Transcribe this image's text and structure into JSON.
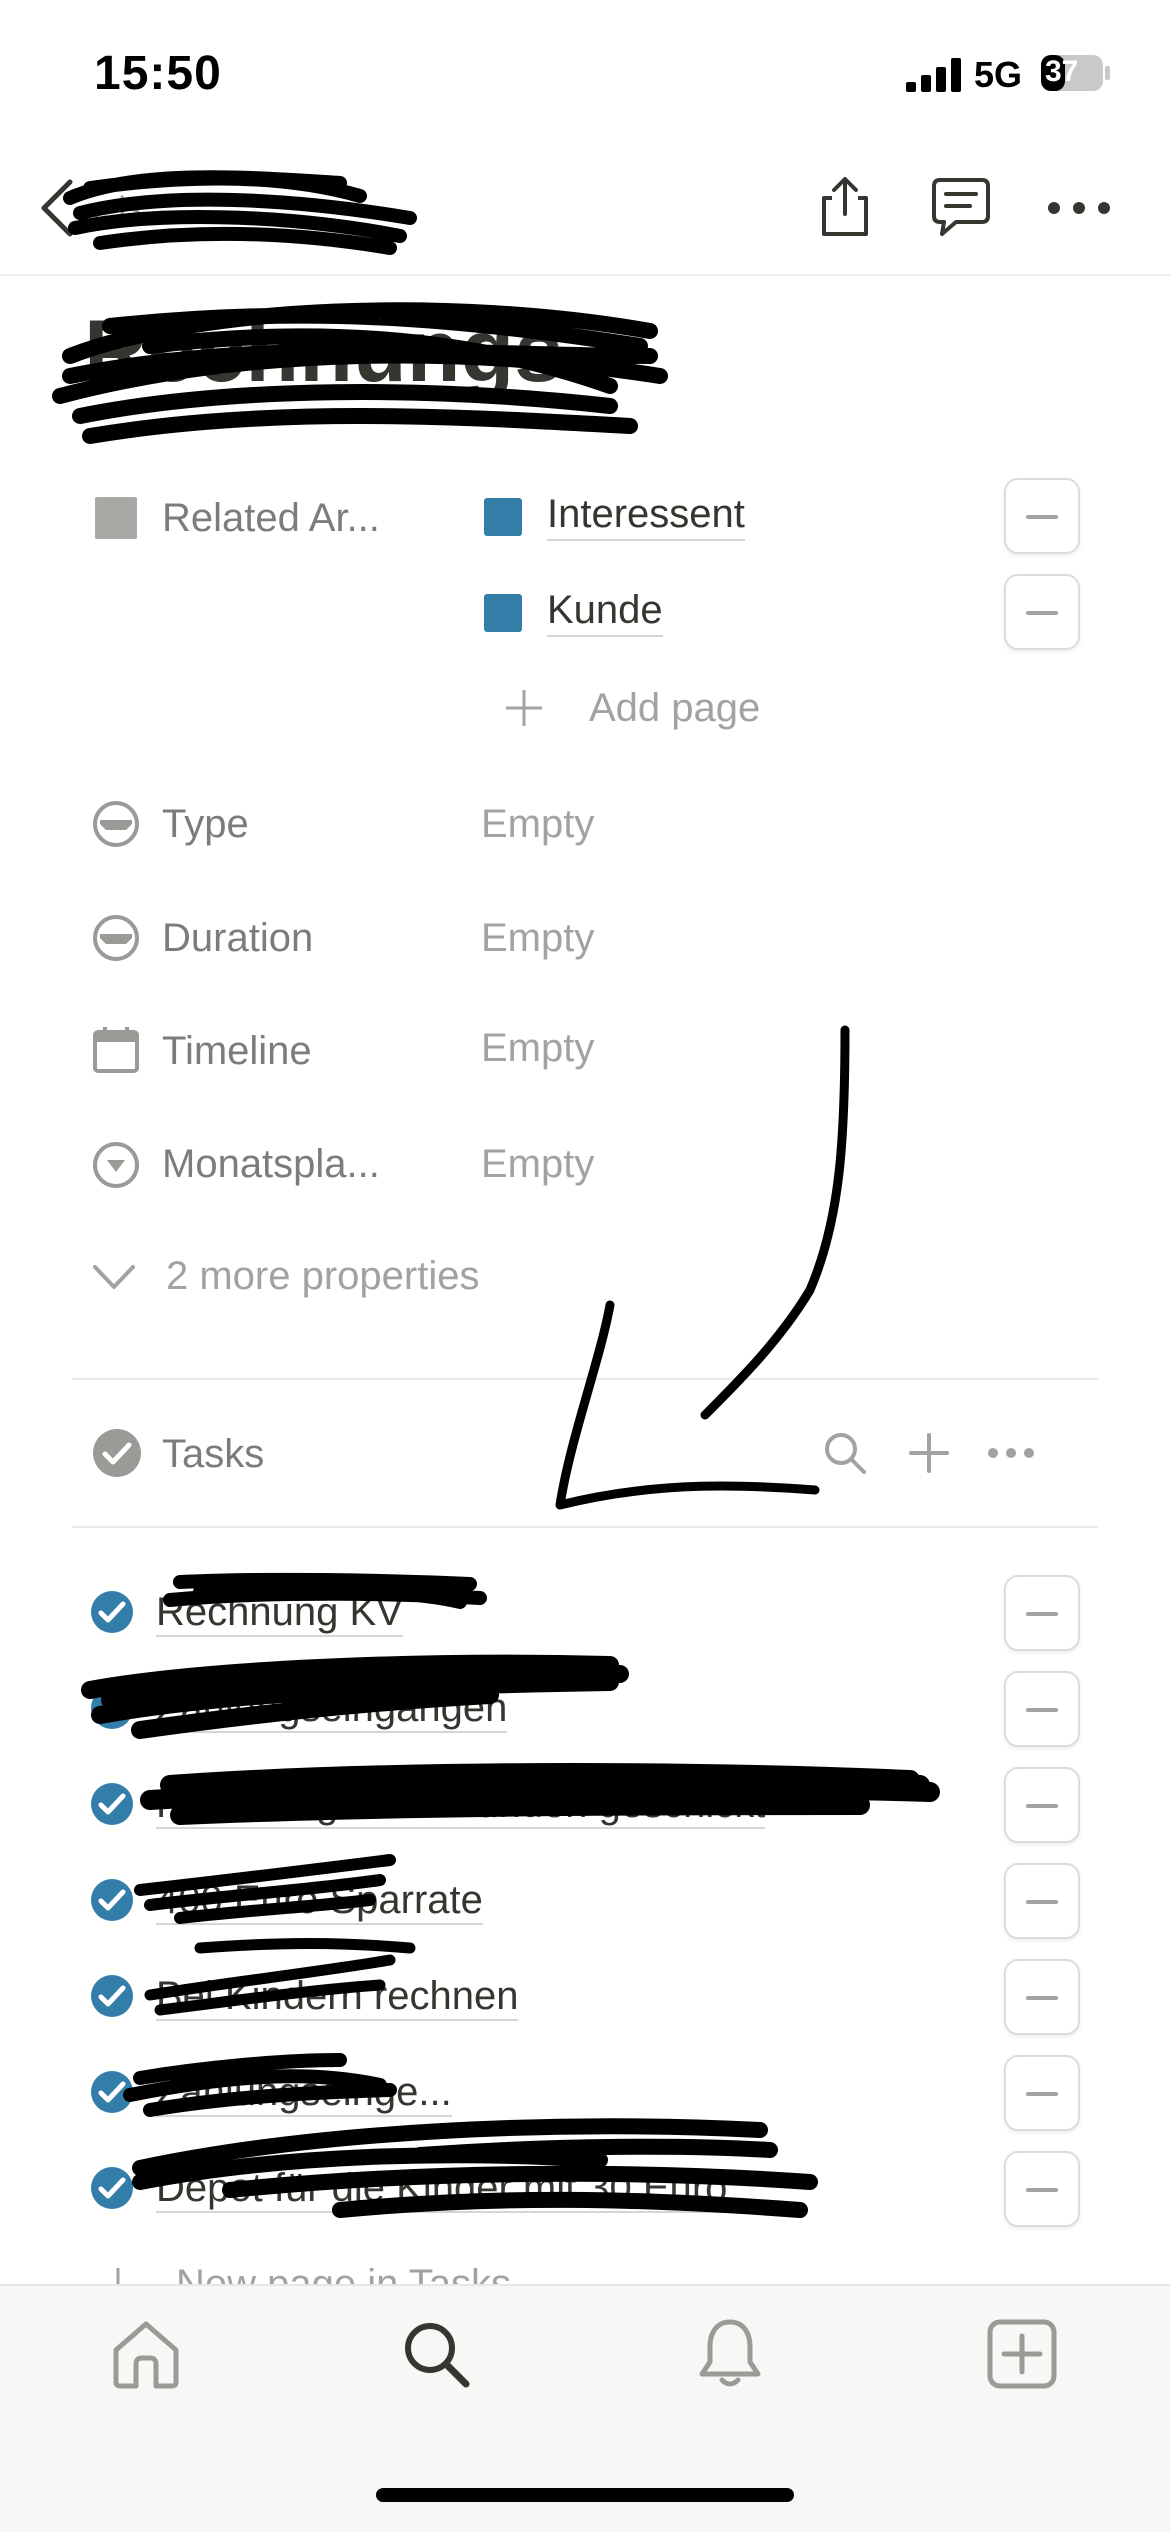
{
  "status_bar": {
    "time": "15:50",
    "network": "5G",
    "battery": "37"
  },
  "nav": {
    "breadcrumb": "...is"
  },
  "page": {
    "title": "Rechnungs"
  },
  "properties": {
    "related_area": {
      "label": "Related Ar...",
      "items": [
        {
          "label": "Interessent",
          "color": "#337ea9"
        },
        {
          "label": "Kunde",
          "color": "#337ea9"
        }
      ],
      "add_page": "Add page"
    },
    "type": {
      "label": "Type",
      "value": "Empty"
    },
    "duration": {
      "label": "Duration",
      "value": "Empty"
    },
    "timeline": {
      "label": "Timeline",
      "value": "Empty"
    },
    "monatsplan": {
      "label": "Monatspla...",
      "value": "Empty"
    },
    "more": "2 more properties"
  },
  "tasks": {
    "title": "Tasks",
    "items": [
      {
        "text": "Rechnung KV",
        "done": true
      },
      {
        "text": "Zahlungseingangen",
        "done": true
      },
      {
        "text": "Rechnungen an Kunden geschickt",
        "done": true
      },
      {
        "text": "400 Euro Sparrate",
        "done": true
      },
      {
        "text": "Bei Kindern rechnen",
        "done": true
      },
      {
        "text": "Zahlungseinge...",
        "done": true
      },
      {
        "text": "Depot für die Kinder mit 30 Euro",
        "done": true
      }
    ],
    "new_page": "New page in Tasks"
  },
  "tab_bar": [
    "home-icon",
    "search-icon",
    "bell-icon",
    "new-page-icon"
  ],
  "colors": {
    "accent": "#337ea9",
    "muted": "#a3a29f",
    "text": "#37352f"
  }
}
